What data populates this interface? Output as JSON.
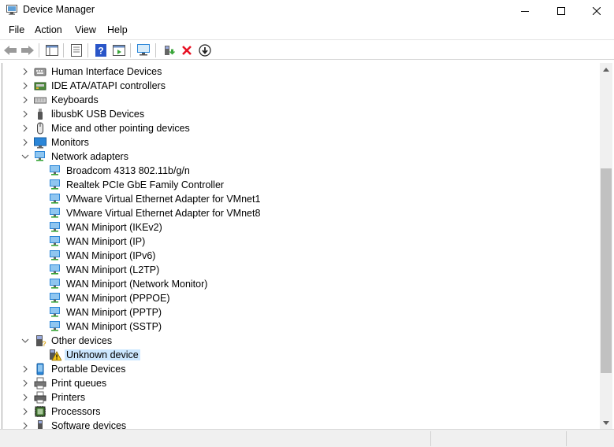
{
  "window": {
    "title": "Device Manager",
    "controls": {
      "minimize": "minimize",
      "maximize": "maximize",
      "close": "close"
    }
  },
  "menu": [
    "File",
    "Action",
    "View",
    "Help"
  ],
  "toolbar": {
    "buttons": [
      "back-icon",
      "forward-icon",
      "show-hide-console-tree-icon",
      "properties-icon",
      "help-icon",
      "action-pane-icon",
      "scan-hardware-changes-icon",
      "update-driver-icon",
      "uninstall-device-icon",
      "disable-device-icon"
    ]
  },
  "tree": {
    "items": [
      {
        "label": "Human Interface Devices",
        "icon": "hid-icon",
        "expanded": false
      },
      {
        "label": "IDE ATA/ATAPI controllers",
        "icon": "ide-controller-icon",
        "expanded": false
      },
      {
        "label": "Keyboards",
        "icon": "keyboard-icon",
        "expanded": false
      },
      {
        "label": "libusbK USB Devices",
        "icon": "usb-icon",
        "expanded": false
      },
      {
        "label": "Mice and other pointing devices",
        "icon": "mouse-icon",
        "expanded": false
      },
      {
        "label": "Monitors",
        "icon": "monitor-icon",
        "expanded": false
      },
      {
        "label": "Network adapters",
        "icon": "network-adapter-icon",
        "expanded": true,
        "children": [
          "Broadcom 4313 802.11b/g/n",
          "Realtek PCIe GbE Family Controller",
          "VMware Virtual Ethernet Adapter for VMnet1",
          "VMware Virtual Ethernet Adapter for VMnet8",
          "WAN Miniport (IKEv2)",
          "WAN Miniport (IP)",
          "WAN Miniport (IPv6)",
          "WAN Miniport (L2TP)",
          "WAN Miniport (Network Monitor)",
          "WAN Miniport (PPPOE)",
          "WAN Miniport (PPTP)",
          "WAN Miniport (SSTP)"
        ]
      },
      {
        "label": "Other devices",
        "icon": "other-devices-icon",
        "expanded": true,
        "children": [
          "Unknown device"
        ],
        "selected_child": "Unknown device"
      },
      {
        "label": "Portable Devices",
        "icon": "portable-device-icon",
        "expanded": false
      },
      {
        "label": "Print queues",
        "icon": "print-queue-icon",
        "expanded": false
      },
      {
        "label": "Printers",
        "icon": "printer-icon",
        "expanded": false
      },
      {
        "label": "Processors",
        "icon": "processor-icon",
        "expanded": false
      },
      {
        "label": "Software devices",
        "icon": "software-device-icon",
        "expanded": false
      }
    ]
  },
  "colors": {
    "selection": "#cce8ff",
    "network_blue": "#2b86d8",
    "network_green": "#3aa63a",
    "warning_yellow": "#f5c518",
    "uninstall_red": "#e81123",
    "help_blue": "#2955c8"
  }
}
